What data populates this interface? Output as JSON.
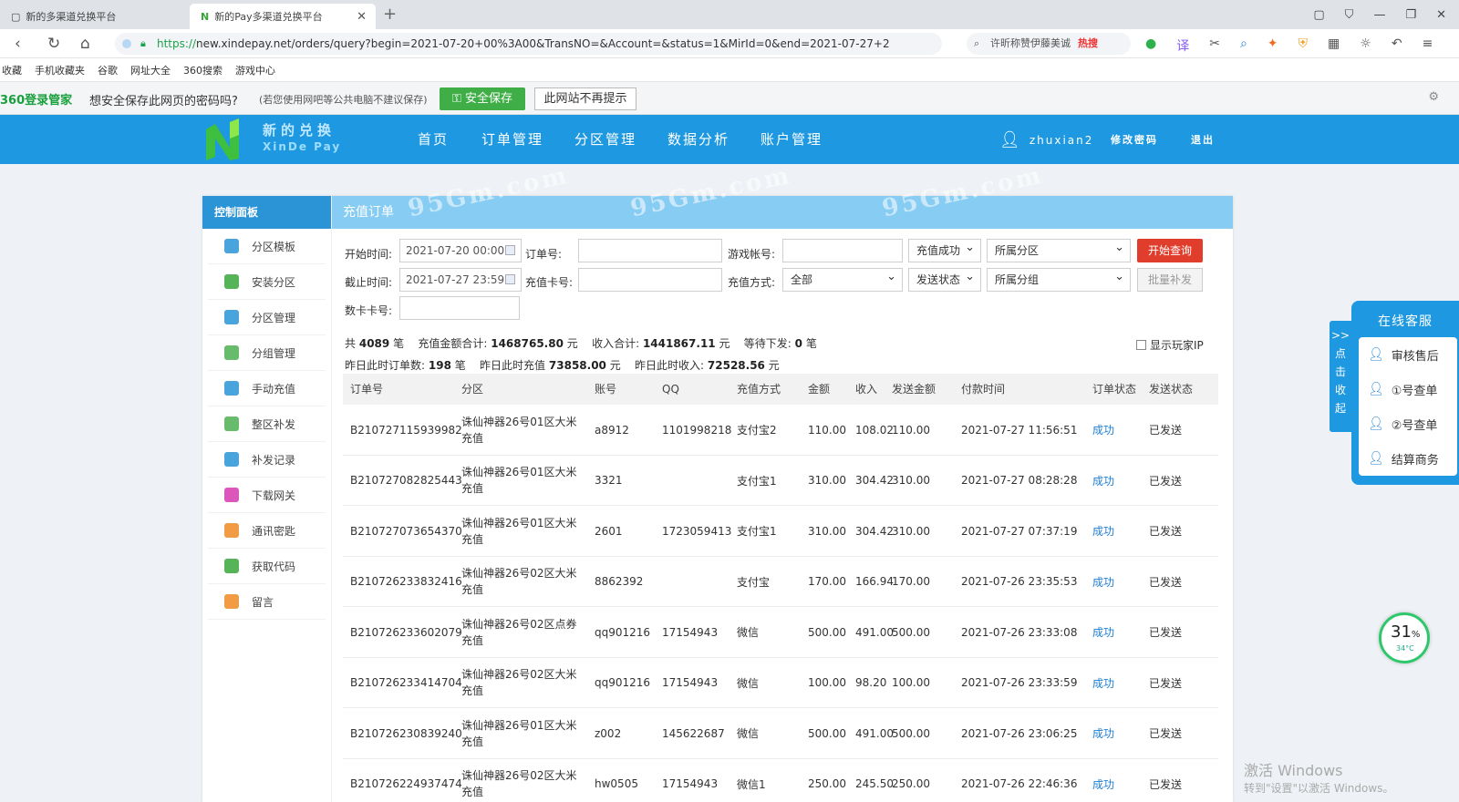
{
  "browser": {
    "tabs": [
      {
        "title": "新的多渠道兑换平台"
      },
      {
        "title": "新的Pay多渠道兑换平台"
      }
    ],
    "url_scheme": "https://",
    "url_rest": "new.xindepay.net/orders/query?begin=2021-07-20+00%3A00&TransNO=&Account=&status=1&MirId=0&end=2021-07-27+2",
    "search_text": "许昕称赞伊藤美诚",
    "search_hot": "热搜",
    "bookmarks": [
      "收藏",
      "手机收藏夹",
      "谷歌",
      "网址大全",
      "360搜索",
      "游戏中心"
    ]
  },
  "password_bar": {
    "brand": "360登录管家",
    "question": "想安全保存此网页的密码吗?",
    "note": "(若您使用网吧等公共电脑不建议保存)",
    "save_label": "安全保存",
    "never_label": "此网站不再提示"
  },
  "header": {
    "logo_cn": "新的兑换",
    "logo_en": "XinDe Pay",
    "nav": [
      "首页",
      "订单管理",
      "分区管理",
      "数据分析",
      "账户管理"
    ],
    "username": "zhuxian2",
    "change_pwd": "修改密码",
    "logout": "退出"
  },
  "sidebar": {
    "title": "控制面板",
    "items": [
      {
        "label": "分区模板",
        "icon": "copy-icon",
        "color": "#2a94d6"
      },
      {
        "label": "安装分区",
        "icon": "wrench-icon",
        "color": "#3aa63a"
      },
      {
        "label": "分区管理",
        "icon": "inbox-icon",
        "color": "#2a94d6"
      },
      {
        "label": "分组管理",
        "icon": "users-icon",
        "color": "#4caf50"
      },
      {
        "label": "手动充值",
        "icon": "send-icon",
        "color": "#2a94d6"
      },
      {
        "label": "整区补发",
        "icon": "calendar-icon",
        "color": "#4caf50"
      },
      {
        "label": "补发记录",
        "icon": "copy-icon",
        "color": "#2a94d6"
      },
      {
        "label": "下载网关",
        "icon": "tray-icon",
        "color": "#d63ab0"
      },
      {
        "label": "通讯密匙",
        "icon": "key-icon",
        "color": "#f08a24"
      },
      {
        "label": "获取代码",
        "icon": "briefcase-icon",
        "color": "#3aa63a"
      },
      {
        "label": "留言",
        "icon": "pencil-icon",
        "color": "#f08a24"
      }
    ]
  },
  "panel": {
    "title": "充值订单",
    "watermark": "95Gm.com"
  },
  "filters": {
    "start_label": "开始时间:",
    "start_value": "2021-07-20 00:00",
    "end_label": "截止时间:",
    "end_value": "2021-07-27 23:59",
    "order_label": "订单号:",
    "card_label": "充值卡号:",
    "account_label": "游戏帐号:",
    "method_label": "充值方式:",
    "method_value": "全部",
    "status_value": "充值成功",
    "send_value": "发送状态",
    "zone_value": "所属分区",
    "group_value": "所属分组",
    "query_btn": "开始查询",
    "batch_btn": "批量补发",
    "numcard_label": "数卡卡号:"
  },
  "stats": {
    "line1": [
      {
        "pre": "共",
        "val": "4089",
        "post": "笔"
      },
      {
        "pre": "充值金额合计:",
        "val": "1468765.80",
        "post": "元"
      },
      {
        "pre": "收入合计:",
        "val": "1441867.11",
        "post": "元"
      },
      {
        "pre": "等待下发:",
        "val": "0",
        "post": "笔"
      }
    ],
    "line2": [
      {
        "pre": "昨日此时订单数:",
        "val": "198",
        "post": "笔"
      },
      {
        "pre": "昨日此时充值",
        "val": "73858.00",
        "post": "元"
      },
      {
        "pre": "昨日此时收入:",
        "val": "72528.56",
        "post": "元"
      }
    ],
    "show_ip": "显示玩家IP"
  },
  "table": {
    "headers": [
      "订单号",
      "分区",
      "账号",
      "QQ",
      "充值方式",
      "金额",
      "收入",
      "发送金额",
      "付款时间",
      "订单状态",
      "发送状态"
    ],
    "rows": [
      [
        "B210727115939982",
        "诛仙神器26号01区大米充值",
        "a8912",
        "1101998218",
        "支付宝2",
        "110.00",
        "108.02",
        "110.00",
        "2021-07-27 11:56:51",
        "成功",
        "已发送"
      ],
      [
        "B210727082825443",
        "诛仙神器26号01区大米充值",
        "3321",
        "",
        "支付宝1",
        "310.00",
        "304.42",
        "310.00",
        "2021-07-27 08:28:28",
        "成功",
        "已发送"
      ],
      [
        "B210727073654370",
        "诛仙神器26号01区大米充值",
        "2601",
        "1723059413",
        "支付宝1",
        "310.00",
        "304.42",
        "310.00",
        "2021-07-27 07:37:19",
        "成功",
        "已发送"
      ],
      [
        "B210726233832416",
        "诛仙神器26号02区大米充值",
        "8862392",
        "",
        "支付宝",
        "170.00",
        "166.94",
        "170.00",
        "2021-07-26 23:35:53",
        "成功",
        "已发送"
      ],
      [
        "B210726233602079",
        "诛仙神器26号02区点券充值",
        "qq901216",
        "17154943",
        "微信",
        "500.00",
        "491.00",
        "500.00",
        "2021-07-26 23:33:08",
        "成功",
        "已发送"
      ],
      [
        "B210726233414704",
        "诛仙神器26号02区大米充值",
        "qq901216",
        "17154943",
        "微信",
        "100.00",
        "98.20",
        "100.00",
        "2021-07-26 23:33:59",
        "成功",
        "已发送"
      ],
      [
        "B210726230839240",
        "诛仙神器26号01区大米充值",
        "z002",
        "145622687",
        "微信",
        "500.00",
        "491.00",
        "500.00",
        "2021-07-26 23:06:25",
        "成功",
        "已发送"
      ],
      [
        "B210726224937474",
        "诛仙神器26号02区大米充值",
        "hw0505",
        "17154943",
        "微信1",
        "250.00",
        "245.50",
        "250.00",
        "2021-07-26 22:46:36",
        "成功",
        "已发送"
      ]
    ]
  },
  "service": {
    "title": "在线客服",
    "tab_text": ">> 点 击 收 起",
    "items": [
      "审核售后",
      "①号查单",
      "②号查单",
      "结算商务"
    ]
  },
  "gauge": {
    "value": "31",
    "unit": "%",
    "temp": "34°C"
  },
  "windows_watermark": {
    "line1": "激活 Windows",
    "line2": "转到\"设置\"以激活 Windows。"
  }
}
